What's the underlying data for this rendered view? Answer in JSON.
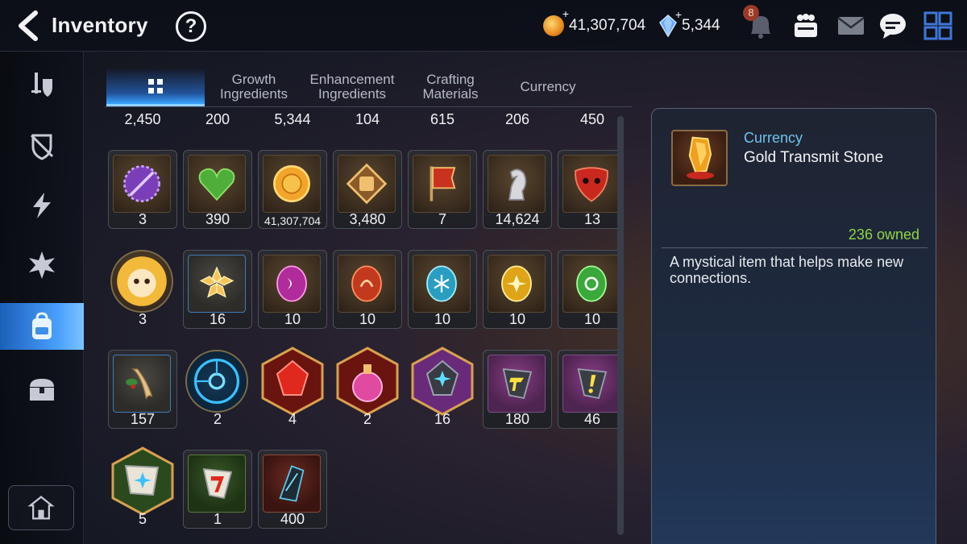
{
  "header": {
    "title": "Inventory",
    "help": "?",
    "gold": "41,307,704",
    "gems": "5,344",
    "notification_count": "8"
  },
  "tabs": [
    {
      "label": "",
      "icon": "grid-icon"
    },
    {
      "label": "Growth\nIngredients"
    },
    {
      "label": "Enhancement\nIngredients"
    },
    {
      "label": "Crafting\nMaterials"
    },
    {
      "label": "Currency"
    }
  ],
  "sidebar": {
    "items": [
      "equipment-icon",
      "artifact-icon",
      "catalyst-icon",
      "memory-icon",
      "bag-icon",
      "chest-icon"
    ],
    "active_index": 4
  },
  "grid": {
    "top_row": [
      "2,450",
      "200",
      "5,344",
      "104",
      "615",
      "206",
      "450"
    ],
    "rows": [
      [
        {
          "name": "purple-seal-coin",
          "qty": "3"
        },
        {
          "name": "green-heart",
          "qty": "390"
        },
        {
          "name": "gold-coin",
          "qty": "41,307,704"
        },
        {
          "name": "fist-emblem",
          "qty": "3,480"
        },
        {
          "name": "red-banner",
          "qty": "7"
        },
        {
          "name": "silver-knight",
          "qty": "14,624"
        },
        {
          "name": "red-mask-emblem",
          "qty": "13"
        }
      ],
      [
        {
          "name": "lion-portrait",
          "qty": "3"
        },
        {
          "name": "gold-flower",
          "qty": "16"
        },
        {
          "name": "dark-rune",
          "qty": "10"
        },
        {
          "name": "fire-rune",
          "qty": "10"
        },
        {
          "name": "ice-rune",
          "qty": "10"
        },
        {
          "name": "light-rune",
          "qty": "10"
        },
        {
          "name": "earth-rune",
          "qty": "10"
        }
      ],
      [
        {
          "name": "root-herb",
          "qty": "157"
        },
        {
          "name": "blue-tech-disc",
          "qty": "2"
        },
        {
          "name": "red-crystal",
          "qty": "4"
        },
        {
          "name": "pink-potion",
          "qty": "2"
        },
        {
          "name": "purple-crystal",
          "qty": "16"
        },
        {
          "name": "yellow-tag-stone",
          "qty": "180"
        },
        {
          "name": "yellow-mark-stone",
          "qty": "46"
        }
      ],
      [
        {
          "name": "blue-star-stone",
          "qty": "5"
        },
        {
          "name": "red-seven-stone",
          "qty": "1"
        },
        {
          "name": "dark-crystal-shard",
          "qty": "400"
        }
      ]
    ]
  },
  "detail": {
    "category": "Currency",
    "name": "Gold Transmit Stone",
    "owned": "236 owned",
    "description": "A mystical item that helps make new connections."
  },
  "colors": {
    "accent": "#3aa4ff",
    "owned_green": "#8fd444",
    "category_blue": "#6fc3ec"
  }
}
